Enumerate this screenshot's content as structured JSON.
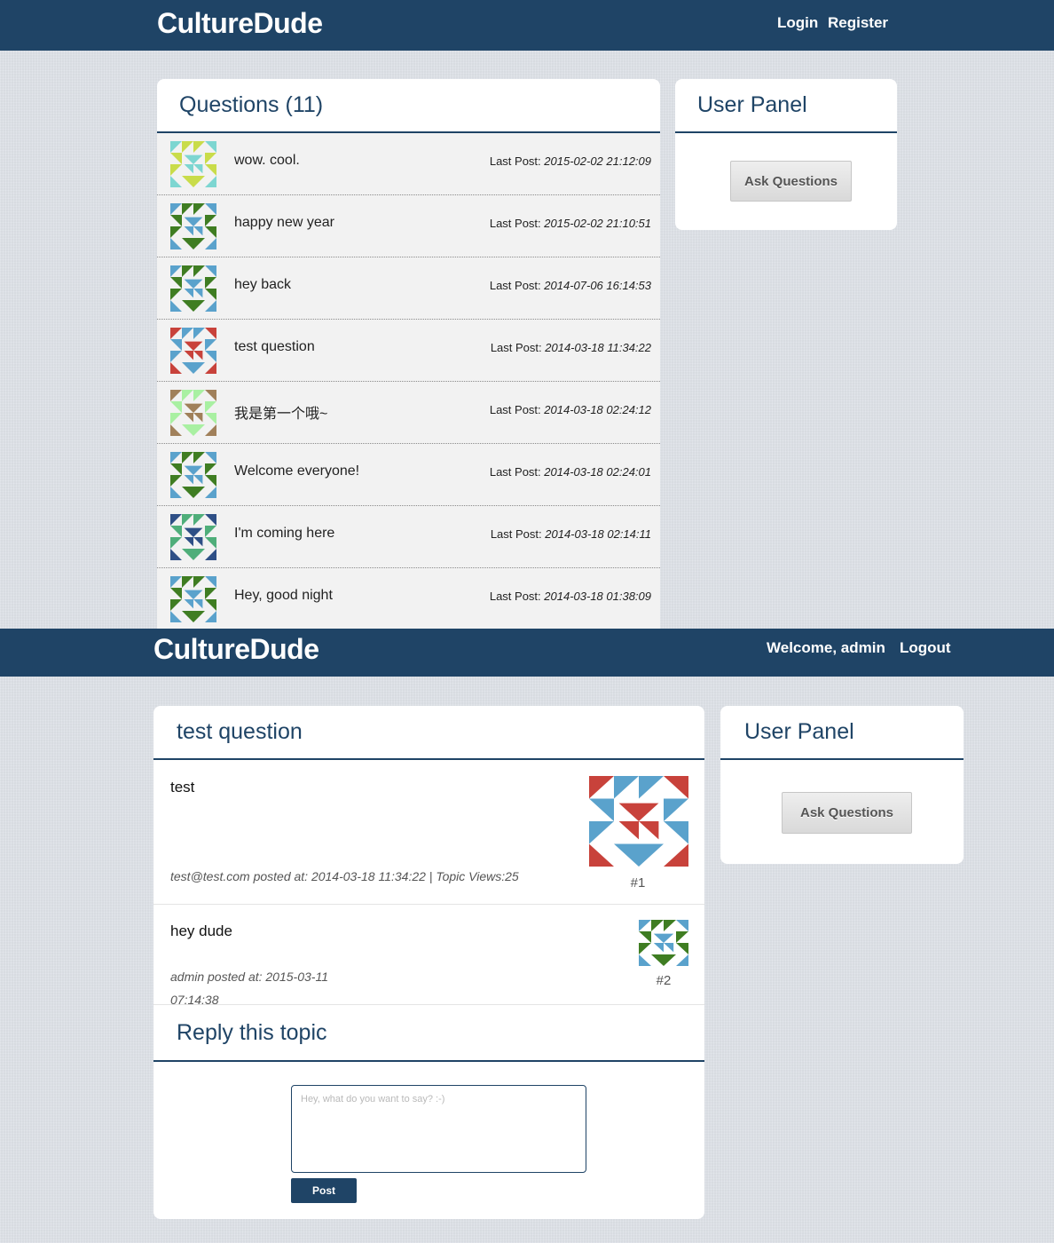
{
  "screen1": {
    "brand": "CultureDude",
    "nav": {
      "login": "Login",
      "register": "Register"
    },
    "questions_title": "Questions (11)",
    "last_post_label": "Last Post:",
    "questions": [
      {
        "title": "wow. cool.",
        "last_post": "2015-02-02 21:12:09",
        "avatar": "identicon-teal-yellow"
      },
      {
        "title": "happy new year",
        "last_post": "2015-02-02 21:10:51",
        "avatar": "identicon-blue-green"
      },
      {
        "title": "hey back",
        "last_post": "2014-07-06 16:14:53",
        "avatar": "identicon-blue-green"
      },
      {
        "title": "test question",
        "last_post": "2014-03-18 11:34:22",
        "avatar": "identicon-red-blue"
      },
      {
        "title": "我是第一个哦~",
        "last_post": "2014-03-18 02:24:12",
        "avatar": "identicon-brown-green"
      },
      {
        "title": "Welcome everyone!",
        "last_post": "2014-03-18 02:24:01",
        "avatar": "identicon-blue-green"
      },
      {
        "title": "I'm coming here",
        "last_post": "2014-03-18 02:14:11",
        "avatar": "identicon-navy-green"
      },
      {
        "title": "Hey, good night",
        "last_post": "2014-03-18 01:38:09",
        "avatar": "identicon-blue-green"
      }
    ],
    "user_panel": {
      "title": "User Panel",
      "ask_button": "Ask Questions"
    }
  },
  "screen2": {
    "brand": "CultureDude",
    "nav": {
      "welcome": "Welcome, admin",
      "logout": "Logout"
    },
    "topic_title": "test question",
    "posts": [
      {
        "body": "test",
        "meta": "test@test.com posted at: 2014-03-18 11:34:22 | Topic Views:25",
        "number": "#1",
        "avatar": "identicon-red-blue"
      },
      {
        "body": "hey dude",
        "meta_line1": "admin posted at: 2015-03-11",
        "meta_line2": "07:14:38",
        "number": "#2",
        "avatar": "identicon-blue-green"
      }
    ],
    "reply": {
      "title": "Reply this topic",
      "placeholder": "Hey, what do you want to say? :-)",
      "post_button": "Post"
    },
    "user_panel": {
      "title": "User Panel",
      "ask_button": "Ask Questions"
    }
  },
  "colors": {
    "navbar": "#1f4466",
    "page_bg": "#dde1e7",
    "row_bg": "#f2f2f2",
    "identicon_teal": "#7dd6d1",
    "identicon_yellow": "#c9dc4a",
    "identicon_blue": "#5aa2cc",
    "identicon_green": "#3f7d22",
    "identicon_red": "#c8423b",
    "identicon_brown": "#a0805a",
    "identicon_mint": "#a9f0a2",
    "identicon_navy": "#2e4f86"
  }
}
